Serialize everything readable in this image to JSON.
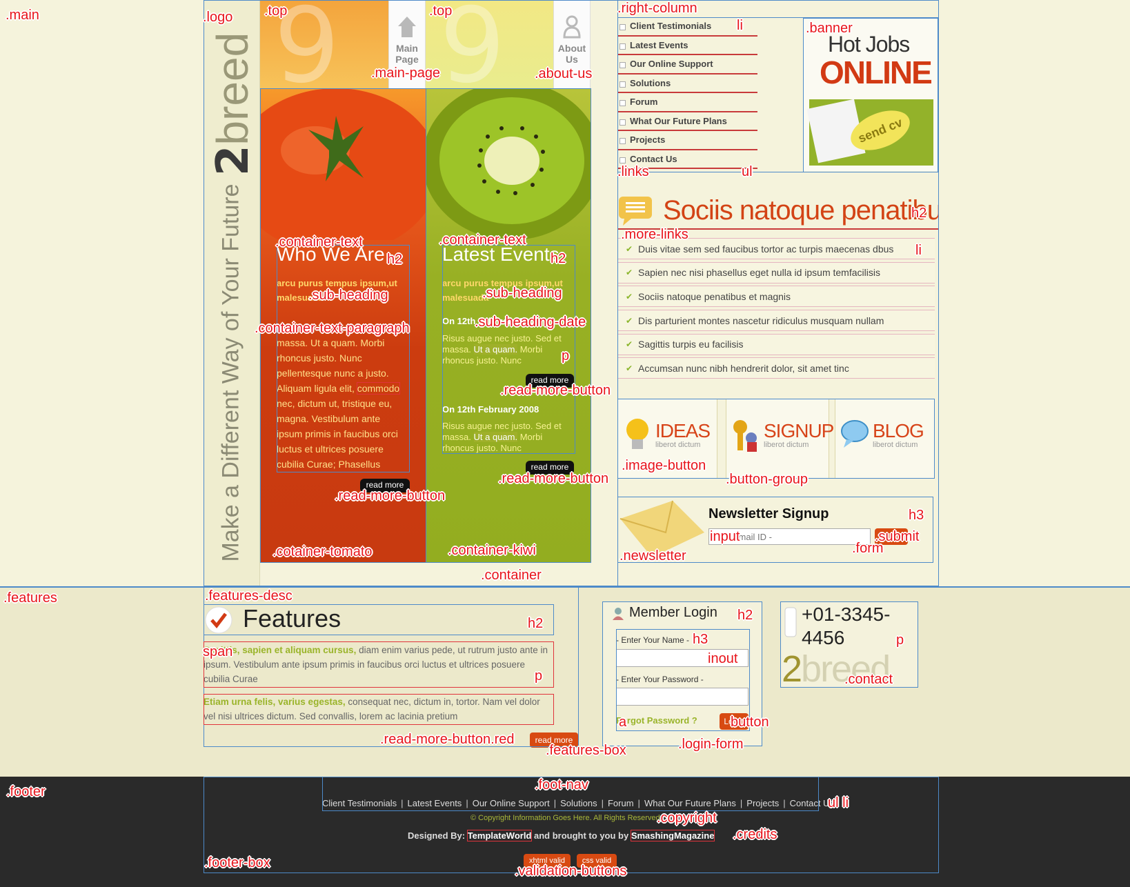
{
  "annotations": {
    "main": ".main",
    "logo": ".logo",
    "top1": ".top",
    "top2": ".top",
    "main_page": ".main-page",
    "about_us": ".about-us",
    "right_column": ".right-column",
    "banner": ".banner",
    "li1": "li",
    "links": ".links",
    "ul1": "ul",
    "h2_sociis": "h2",
    "more_links": ".more-links",
    "li2": "li",
    "container_text1": ".container-text",
    "container_text2": ".container-text",
    "h2_who": "h2",
    "h2_latest": "h2",
    "sub_heading1": ".sub-heading",
    "sub_heading2": ".sub-heading",
    "sub_heading_date": ".sub-heading-date",
    "container_text_paragraph": ".container-text-paragraph",
    "p1": "p",
    "read_more_button1": ".read-more-button",
    "read_more_button2": ".read-more-button",
    "read_more_button3": ".read-more-button",
    "cotainer_tomato": ".cotainer-tomato",
    "container_kiwi": ".container-kiwi",
    "container": ".container",
    "image_button": ".image-button",
    "button_group": ".button-group",
    "newsletter": ".newsletter",
    "h3_newsletter": "h3",
    "input1": "input",
    "submit": ".submit",
    "form": ".form",
    "features": ".features",
    "features_desc": ".features-desc",
    "h2_features": "h2",
    "span": "span",
    "p_feat": "p",
    "read_more_button_red": ".read-more-button.red",
    "features_box": ".features-box",
    "h2_member": "h2",
    "h3_member": "h3",
    "inout": "inout",
    "a": "a",
    "button": "button",
    "login_form": ".login-form",
    "p_contact": "p",
    "contact": ".contact",
    "footer": ".footer",
    "foot_nav": ".foot-nav",
    "ul_li": "ul li",
    "copyright": ".copyright",
    "credits": ".credits",
    "footer_box": ".footer-box",
    "validation_buttons": ".validation-buttons"
  },
  "logo": {
    "number": "2",
    "word": "breed",
    "tagline": "Make a Different Way of Your Future"
  },
  "nav": {
    "main_page": "Main\nPage",
    "about_us": "About\nUs"
  },
  "tomato": {
    "title": "Who We Are",
    "sub_heading": "arcu purus tempus ipsum,ut malesuada",
    "paragraph_before": "massa. Ut a quam. Morbi rhoncus justo. Nunc pellentesque nunc a justo. Aliquam ligula elit, ",
    "paragraph_link": "commodo",
    "paragraph_after": " nec, dictum ut, tristique eu, magna. Vestibulum ante ipsum primis in faucibus orci luctus et ultrices posuere cubilia Curae; Phasellus cursus",
    "read_more": "read more"
  },
  "kiwi": {
    "title": "Latest Events",
    "sub_heading": "arcu purus tempus ipsum,ut malesuada",
    "date1": "On 12th February 2008",
    "date2": "On 12th February 2008",
    "para_before": "Risus augue nec justo. Sed et massa. ",
    "para_hl": "Ut a quam.",
    "para_after": " Morbi rhoncus justo. Nunc",
    "read_more": "read more"
  },
  "links": [
    "Client Testimonials",
    "Latest Events",
    "Our Online Support",
    "Solutions",
    "Forum",
    "What Our Future Plans",
    "Projects",
    "Contact Us"
  ],
  "banner": {
    "line1": "Hot Jobs",
    "line2": "ONLINE",
    "cta": "send cv"
  },
  "sociis": {
    "title": "Sociis natoque penatibus"
  },
  "more_links": [
    "Duis vitae sem sed faucibus tortor ac turpis maecenas dbus",
    "Sapien nec nisi phasellus eget nulla id ipsum temfacilisis",
    "Sociis natoque penatibus et magnis",
    "Dis parturient montes nascetur ridiculus musquam nullam",
    "Sagittis turpis eu facilisis",
    "Accumsan nunc nibh hendrerit dolor, sit amet tinc"
  ],
  "image_buttons": [
    {
      "title": "IDEAS",
      "sub": "liberot dictum"
    },
    {
      "title": "SIGNUP",
      "sub": "liberot dictum"
    },
    {
      "title": "BLOG",
      "sub": "liberot dictum"
    }
  ],
  "newsletter": {
    "title": "Newsletter Signup",
    "placeholder": "Your Email ID -"
  },
  "features": {
    "title": "Features",
    "span1": "Sagittis, sapien et aliquam cursus,",
    "p1": " diam enim varius pede, ut rutrum justo ante in ipsum. Vestibulum ante ipsum primis in faucibus orci luctus et ultrices posuere cubilia Curae",
    "span2": "Etiam urna felis, varius egestas,",
    "p2": " consequat nec, dictum in, tortor. Nam vel dolor vel nisi ultrices dictum. Sed convallis, lorem ac lacinia pretium",
    "read_more": "read more"
  },
  "login": {
    "title": "Member Login",
    "name_label": "- Enter Your Name -",
    "password_label": "- Enter Your Password -",
    "forgot": "Forgot Password ?",
    "button": "Login"
  },
  "contact": {
    "phone": "+01-3345-4456",
    "brand_number": "2",
    "brand_word": "breed"
  },
  "footer": {
    "nav": [
      "Client Testimonials",
      "Latest Events",
      "Our Online Support",
      "Solutions",
      "Forum",
      "What Our Future Plans",
      "Projects",
      "Contact Us"
    ],
    "copyright": "© Copyright Information Goes Here. All Rights Reserved",
    "credits_pre": "Designed By: ",
    "credits_link1": "TemplateWorld",
    "credits_mid": " and brought to you by ",
    "credits_link2": "SmashingMagazine",
    "valid1": "xhtml valid",
    "valid2": "css valid"
  },
  "colors": {
    "tomato": "#cc3c0f",
    "kiwi": "#93ad20",
    "accent_red": "#c83a3a",
    "footer": "#2a2a2a",
    "annotation": "#e8141b",
    "box_blue": "#4d8ac9"
  }
}
